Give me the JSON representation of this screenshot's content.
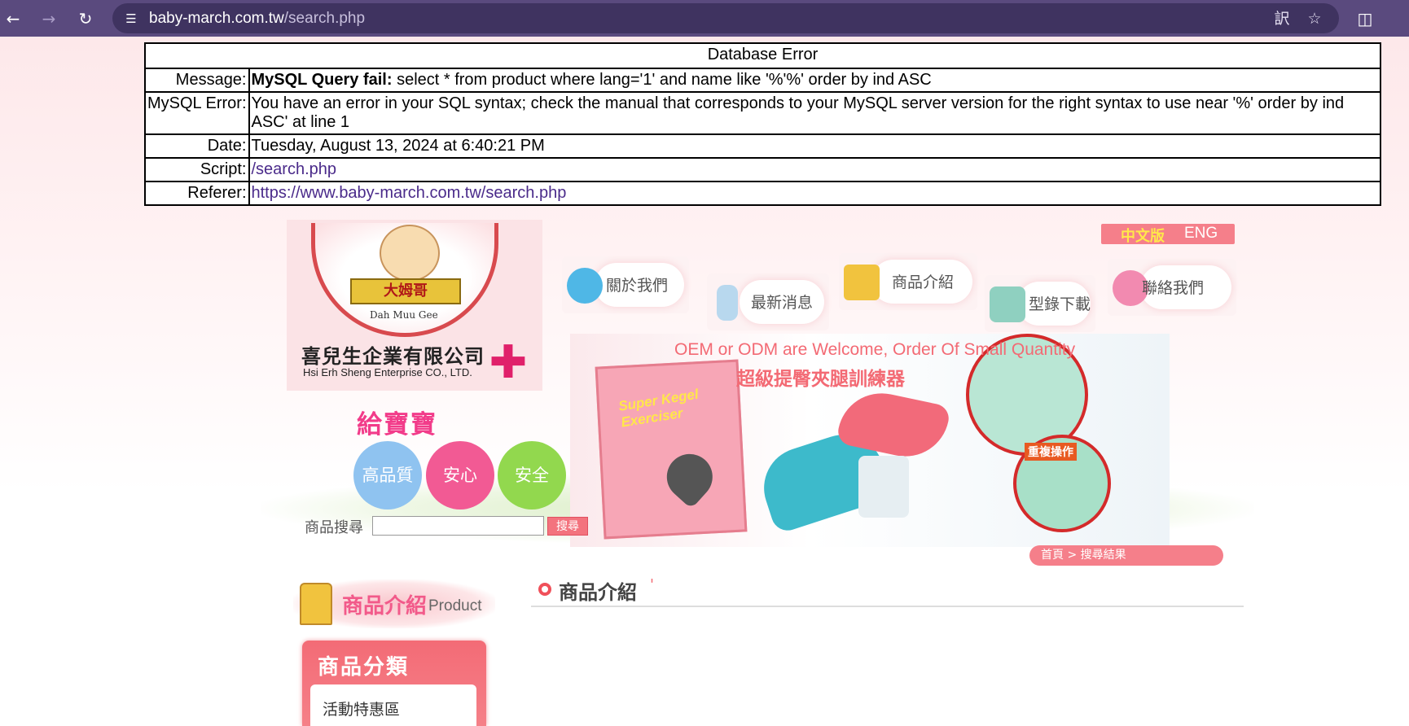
{
  "browser": {
    "url_host": "baby-march.com.tw",
    "url_path": "/search.php"
  },
  "error": {
    "heading": "Database Error",
    "rows": {
      "message": {
        "label": "Message:",
        "bold": "MySQL Query fail:",
        "text": " select * from product where lang='1' and name like '%'%' order by ind ASC"
      },
      "mysql": {
        "label": "MySQL Error:",
        "text": "You have an error in your SQL syntax; check the manual that corresponds to your MySQL server version for the right syntax to use near '%' order by ind ASC' at line 1"
      },
      "date": {
        "label": "Date:",
        "text": "Tuesday, August 13, 2024 at 6:40:21 PM"
      },
      "script": {
        "label": "Script:",
        "link": "/search.php"
      },
      "referer": {
        "label": "Referer:",
        "link": "https://www.baby-march.com.tw/search.php"
      }
    }
  },
  "logo": {
    "ribbon": "大姆哥",
    "brand_en": "Dah Muu Gee",
    "company_cn": "喜兒生企業有限公司",
    "company_en": "Hsi Erh Sheng Enterprise CO., LTD."
  },
  "lang": {
    "zh": "中文版",
    "en": "ENG"
  },
  "nav": {
    "about": "關於我們",
    "news": "最新消息",
    "products": "商品介紹",
    "catalog": "型錄下載",
    "contact": "聯絡我們"
  },
  "banner": {
    "tagline_en": "OEM or ODM are Welcome, Order Of Small Quantity",
    "tagline_cn": "超級提臀夾腿訓練器",
    "box_title": "Super Kegel Exerciser",
    "repeat": "重複操作"
  },
  "promo": {
    "give_baby": "給寶寶",
    "bubbles": [
      "高品質",
      "安心",
      "安全"
    ]
  },
  "search": {
    "label": "商品搜尋",
    "value": "",
    "button": "搜尋"
  },
  "breadcrumb": "首頁 > 搜尋結果",
  "sidebar": {
    "section_cn": "商品介紹",
    "section_en": "Product",
    "category_title": "商品分類",
    "items": [
      "活動特惠區"
    ]
  },
  "main": {
    "title": "商品介紹",
    "query": "'"
  },
  "colors": {
    "chrome": "#5a4a7e",
    "accent_pink": "#f57f8a",
    "lang_highlight": "#ffe84a",
    "bubble_blue": "#8fc3f0",
    "bubble_pink": "#f25a94",
    "bubble_green": "#92d84e"
  }
}
